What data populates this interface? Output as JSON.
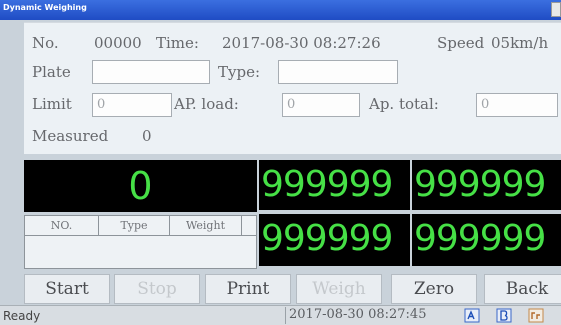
{
  "window": {
    "title": "Dynamic Weighing"
  },
  "info": {
    "no_label": "No.",
    "no_value": "00000",
    "time_label": "Time:",
    "time_value": "2017-08-30 08:27:26",
    "speed_label": "Speed",
    "speed_value": "05km/h",
    "plate_label": "Plate",
    "plate_value": "",
    "type_label": "Type:",
    "type_value": "",
    "limit_label": "Limit",
    "limit_value": "0",
    "ap_load_label": "AP. load:",
    "ap_load_value": "0",
    "ap_total_label": "Ap. total:",
    "ap_total_value": "0",
    "measured_label": "Measured",
    "measured_value": "0"
  },
  "displays": {
    "main": "0",
    "d1": "999999",
    "d2": "999999",
    "d3": "999999",
    "d4": "999999"
  },
  "grid": {
    "columns": [
      "NO.",
      "Type",
      "Weight"
    ]
  },
  "buttons": {
    "start": "Start",
    "stop": "Stop",
    "print": "Print",
    "weigh": "Weigh",
    "zero": "Zero",
    "back": "Back"
  },
  "status": {
    "left": "Ready",
    "time": "2017-08-30 08:27:45"
  },
  "colors": {
    "display_digits": "#46e046",
    "titlebar": "#2a5bd4"
  }
}
